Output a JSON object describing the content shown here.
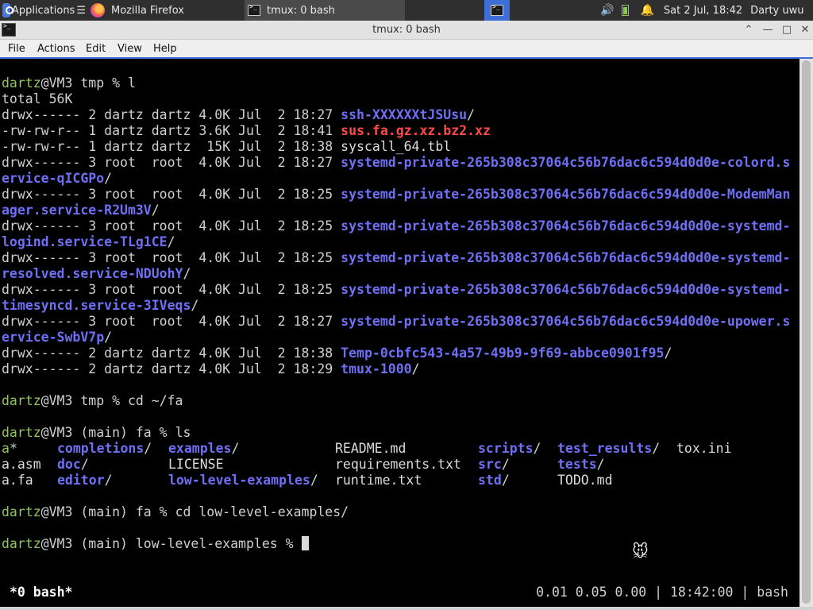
{
  "panel": {
    "applications_label": "Applications",
    "tasks": [
      {
        "label": "Mozilla Firefox"
      },
      {
        "label": "tmux: 0 bash"
      }
    ],
    "volume_icon": "🔊",
    "bell_icon": "🔔",
    "clock": "Sat  2 Jul, 18:42",
    "user": "Darty uwu"
  },
  "window": {
    "title": "tmux: 0 bash",
    "buttons": {
      "up": "⌃",
      "min": "—",
      "max": "□",
      "close": "✕"
    }
  },
  "menu": [
    "File",
    "Actions",
    "Edit",
    "View",
    "Help"
  ],
  "terminal": {
    "prompt_user": "dartz",
    "prompt1": {
      "host_dir": "@VM3 tmp % ",
      "cmd": "l"
    },
    "total": "total 56K",
    "listing": [
      {
        "meta": "drwx------ 2 dartz dartz 4.0K Jul  2 18:27 ",
        "name": "ssh-XXXXXXtJSUsu",
        "suffix": "/",
        "style": "blu"
      },
      {
        "meta": "-rw-rw-r-- 1 dartz dartz 3.6K Jul  2 18:41 ",
        "name": "sus.fa.gz.xz.bz2.xz",
        "suffix": "",
        "style": "red"
      },
      {
        "meta": "-rw-rw-r-- 1 dartz dartz  15K Jul  2 18:38 ",
        "name": "syscall_64.tbl",
        "suffix": "",
        "style": "wht"
      },
      {
        "meta": "drwx------ 3 root  root  4.0K Jul  2 18:27 ",
        "name": "systemd-private-265b308c37064c56b76dac6c594d0d0e-colord.s",
        "suffix": "",
        "style": "blu"
      },
      {
        "meta": "",
        "name": "ervice-qICGPo",
        "suffix": "/",
        "style": "blu"
      },
      {
        "meta": "drwx------ 3 root  root  4.0K Jul  2 18:25 ",
        "name": "systemd-private-265b308c37064c56b76dac6c594d0d0e-ModemMan",
        "suffix": "",
        "style": "blu"
      },
      {
        "meta": "",
        "name": "ager.service-R2Um3V",
        "suffix": "/",
        "style": "blu"
      },
      {
        "meta": "drwx------ 3 root  root  4.0K Jul  2 18:25 ",
        "name": "systemd-private-265b308c37064c56b76dac6c594d0d0e-systemd-",
        "suffix": "",
        "style": "blu"
      },
      {
        "meta": "",
        "name": "logind.service-TLg1CE",
        "suffix": "/",
        "style": "blu"
      },
      {
        "meta": "drwx------ 3 root  root  4.0K Jul  2 18:25 ",
        "name": "systemd-private-265b308c37064c56b76dac6c594d0d0e-systemd-",
        "suffix": "",
        "style": "blu"
      },
      {
        "meta": "",
        "name": "resolved.service-NDUohY",
        "suffix": "/",
        "style": "blu"
      },
      {
        "meta": "drwx------ 3 root  root  4.0K Jul  2 18:25 ",
        "name": "systemd-private-265b308c37064c56b76dac6c594d0d0e-systemd-",
        "suffix": "",
        "style": "blu"
      },
      {
        "meta": "",
        "name": "timesyncd.service-3IVeqs",
        "suffix": "/",
        "style": "blu"
      },
      {
        "meta": "drwx------ 3 root  root  4.0K Jul  2 18:27 ",
        "name": "systemd-private-265b308c37064c56b76dac6c594d0d0e-upower.s",
        "suffix": "",
        "style": "blu"
      },
      {
        "meta": "",
        "name": "ervice-SwbV7p",
        "suffix": "/",
        "style": "blu"
      },
      {
        "meta": "drwx------ 2 dartz dartz 4.0K Jul  2 18:38 ",
        "name": "Temp-0cbfc543-4a57-49b9-9f69-abbce0901f95",
        "suffix": "/",
        "style": "blu"
      },
      {
        "meta": "drwx------ 2 dartz dartz 4.0K Jul  2 18:29 ",
        "name": "tmux-1000",
        "suffix": "/",
        "style": "blu"
      }
    ],
    "prompt2": {
      "host_dir": "@VM3 tmp % ",
      "cmd": "cd ~/fa"
    },
    "prompt3": {
      "host_dir": "@VM3 (main) fa % ",
      "cmd": "ls"
    },
    "ls_rows": [
      [
        {
          "name": "a",
          "suffix": "*",
          "style": "grn"
        },
        {
          "name": "completions",
          "suffix": "/",
          "style": "blu"
        },
        {
          "name": "examples",
          "suffix": "/",
          "style": "blu"
        },
        {
          "name": "README.md",
          "suffix": "",
          "style": "wht"
        },
        {
          "name": "scripts",
          "suffix": "/",
          "style": "blu"
        },
        {
          "name": "test_results",
          "suffix": "/",
          "style": "blu"
        },
        {
          "name": "tox.ini",
          "suffix": "",
          "style": "wht"
        }
      ],
      [
        {
          "name": "a.asm",
          "suffix": "",
          "style": "wht"
        },
        {
          "name": "doc",
          "suffix": "/",
          "style": "blu"
        },
        {
          "name": "LICENSE",
          "suffix": "",
          "style": "wht"
        },
        {
          "name": "requirements.txt",
          "suffix": "",
          "style": "wht"
        },
        {
          "name": "src",
          "suffix": "/",
          "style": "blu"
        },
        {
          "name": "tests",
          "suffix": "/",
          "style": "blu"
        },
        {
          "name": "",
          "suffix": "",
          "style": "wht"
        }
      ],
      [
        {
          "name": "a.fa",
          "suffix": "",
          "style": "wht"
        },
        {
          "name": "editor",
          "suffix": "/",
          "style": "blu"
        },
        {
          "name": "low-level-examples",
          "suffix": "/",
          "style": "blu"
        },
        {
          "name": "runtime.txt",
          "suffix": "",
          "style": "wht"
        },
        {
          "name": "std",
          "suffix": "/",
          "style": "blu"
        },
        {
          "name": "TODO.md",
          "suffix": "",
          "style": "wht"
        },
        {
          "name": "",
          "suffix": "",
          "style": "wht"
        }
      ]
    ],
    "prompt4": {
      "host_dir": "@VM3 (main) fa % ",
      "cmd": "cd low-level-examples/"
    },
    "prompt5": {
      "host_dir": "@VM3 (main) low-level-examples % ",
      "cmd": ""
    }
  },
  "tmux_status": {
    "window": "*0 bash*",
    "right": "0.01 0.05 0.00 | 18:42:00 | bash"
  }
}
